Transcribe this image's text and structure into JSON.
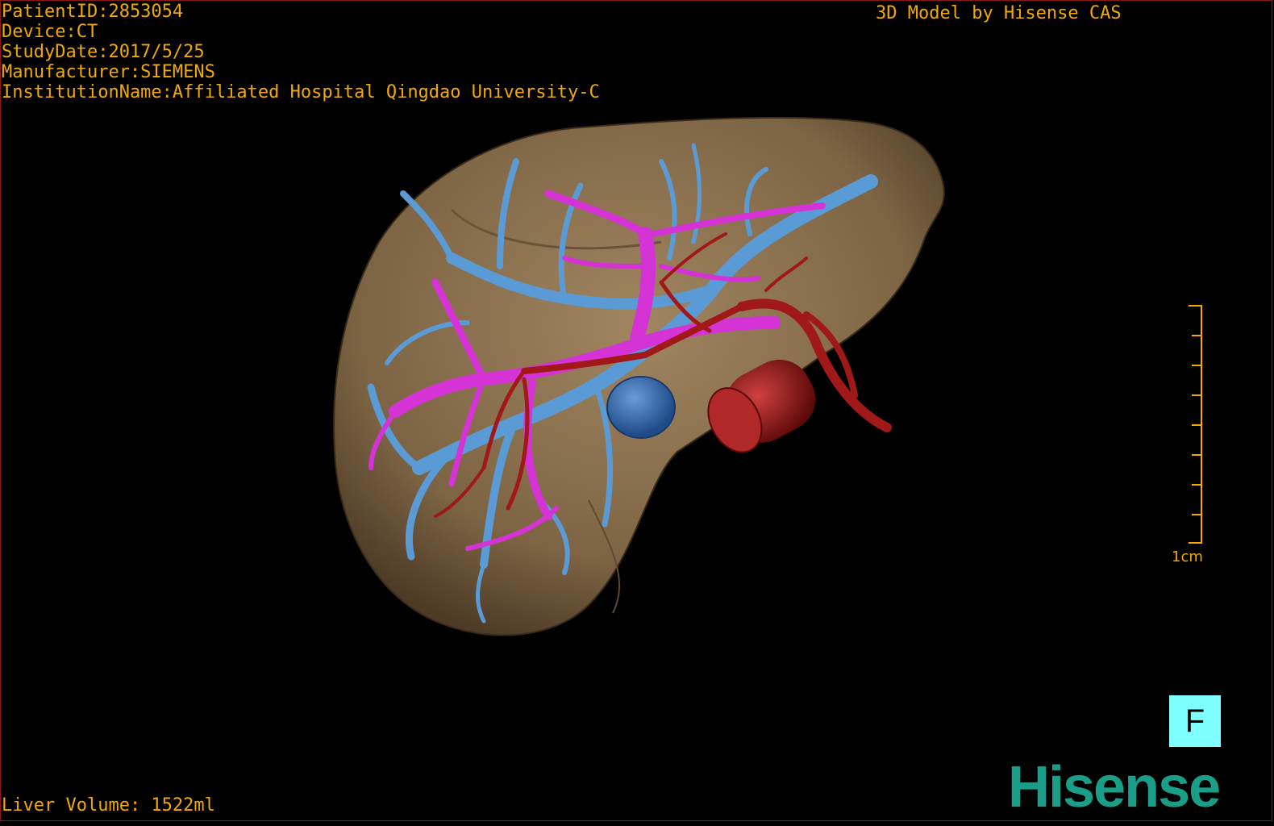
{
  "header": {
    "patient_id": "PatientID:2853054",
    "device": "Device:CT",
    "study_date": "StudyDate:2017/5/25",
    "manufacturer": "Manufacturer:SIEMENS",
    "institution": "InstitutionName:Affiliated Hospital Qingdao University-C",
    "model_credit": "3D Model by Hisense CAS"
  },
  "footer": {
    "liver_volume": "Liver Volume: 1522ml"
  },
  "scale": {
    "label": "1cm"
  },
  "orientation": {
    "label": "F"
  },
  "brand": {
    "logo_text": "Hisense"
  },
  "colors": {
    "overlay_text": "#f2a900",
    "liver": "#8c7350",
    "portal_vein": "#5b9bd5",
    "hepatic_vein": "#d633d6",
    "artery": "#a01818",
    "orientation_button": "#7fffff",
    "logo": "#1a9e88"
  }
}
